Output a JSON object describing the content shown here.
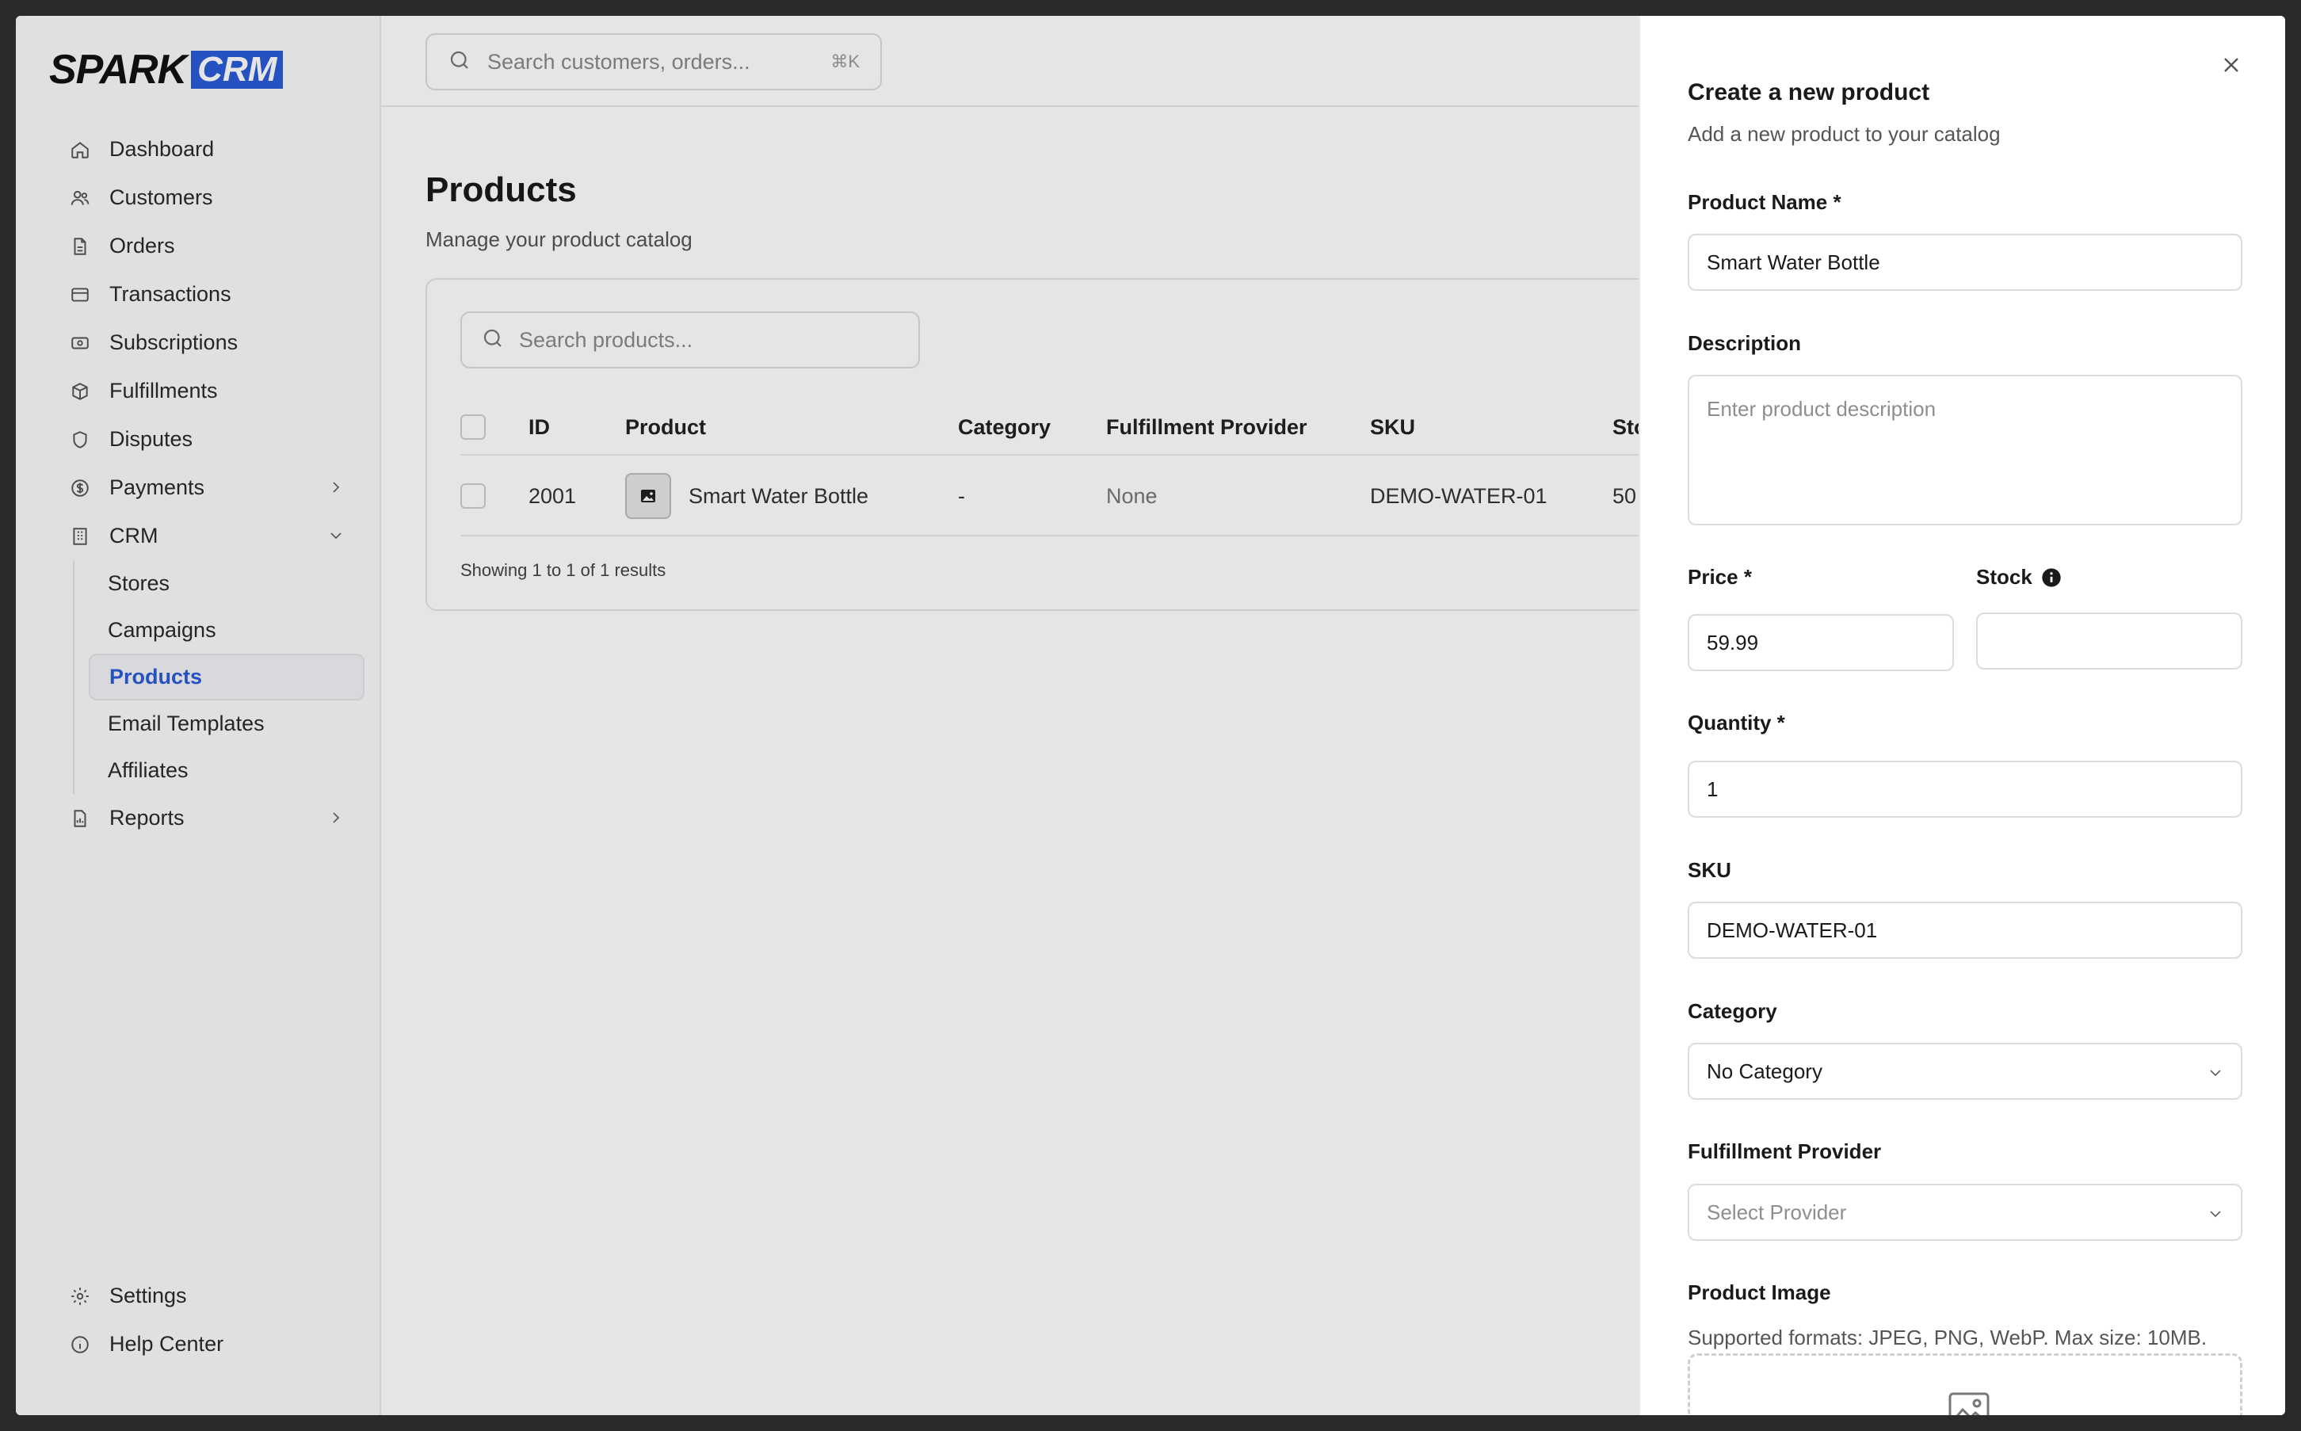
{
  "brand": {
    "name_a": "SPARK",
    "name_b": "CRM"
  },
  "top_search": {
    "placeholder": "Search customers, orders...",
    "shortcut": "⌘K"
  },
  "sidebar": {
    "items": [
      {
        "label": "Dashboard",
        "icon": "home-icon"
      },
      {
        "label": "Customers",
        "icon": "users-icon"
      },
      {
        "label": "Orders",
        "icon": "file-icon"
      },
      {
        "label": "Transactions",
        "icon": "credit-card-icon"
      },
      {
        "label": "Subscriptions",
        "icon": "money-icon"
      },
      {
        "label": "Fulfillments",
        "icon": "box-icon"
      },
      {
        "label": "Disputes",
        "icon": "shield-icon"
      },
      {
        "label": "Payments",
        "icon": "dollar-icon"
      },
      {
        "label": "CRM",
        "icon": "building-icon"
      }
    ],
    "crm_sub": [
      "Stores",
      "Campaigns",
      "Products",
      "Email Templates",
      "Affiliates"
    ],
    "reports": "Reports",
    "settings": "Settings",
    "help": "Help Center",
    "active": "Products",
    "accent": "#2a5bd7"
  },
  "page": {
    "title": "Products",
    "subtitle": "Manage your product catalog",
    "search_placeholder": "Search products...",
    "columns": [
      "ID",
      "Product",
      "Category",
      "Fulfillment Provider",
      "SKU",
      "Sto"
    ],
    "rows": [
      {
        "id": "2001",
        "product": "Smart Water Bottle",
        "category": "-",
        "provider": "None",
        "sku": "DEMO-WATER-01",
        "stock": "50"
      }
    ],
    "showing": "Showing 1 to 1 of 1 results"
  },
  "panel": {
    "title": "Create a new product",
    "subtitle": "Add a new product to your catalog",
    "name_label": "Product Name *",
    "name_value": "Smart Water Bottle",
    "desc_label": "Description",
    "desc_placeholder": "Enter product description",
    "price_label": "Price *",
    "price_value": "59.99",
    "stock_label": "Stock",
    "quantity_label": "Quantity *",
    "quantity_value": "1",
    "sku_label": "SKU",
    "sku_value": "DEMO-WATER-01",
    "category_label": "Category",
    "category_value": "No Category",
    "provider_label": "Fulfillment Provider",
    "provider_placeholder": "Select Provider",
    "image_label": "Product Image",
    "image_hint": "Supported formats: JPEG, PNG, WebP. Max size: 10MB."
  }
}
